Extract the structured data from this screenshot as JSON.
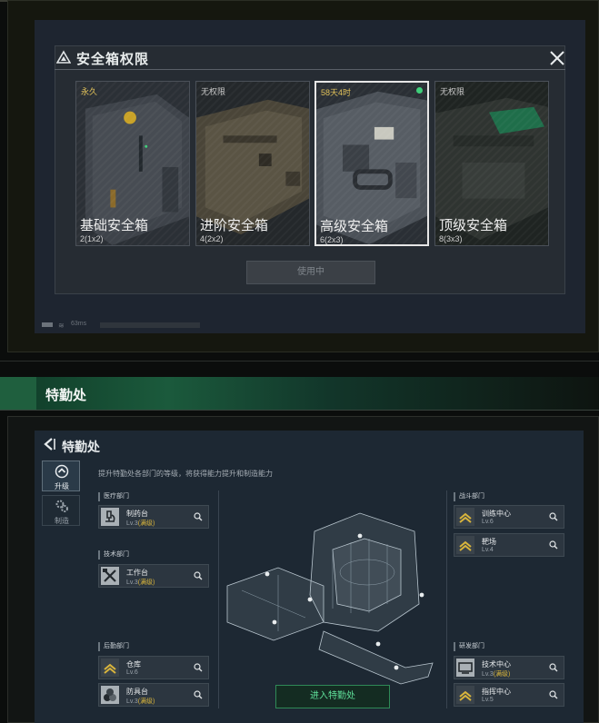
{
  "safebox": {
    "title": "安全箱权限",
    "cards": [
      {
        "tag": "永久",
        "name": "基础安全箱",
        "size": "2(1x2)"
      },
      {
        "tag": "无权限",
        "name": "进阶安全箱",
        "size": "4(2x2)"
      },
      {
        "tag": "58天4时",
        "name": "高级安全箱",
        "size": "6(2x3)"
      },
      {
        "tag": "无权限",
        "name": "顶级安全箱",
        "size": "8(3x3)"
      }
    ],
    "use_button": "使用中",
    "status_text": "63ms"
  },
  "section": {
    "title": "特勤处"
  },
  "special_service": {
    "title": "特勤处",
    "description": "提升特勤处各部门的等级，将获得能力提升和制造能力",
    "tabs": [
      {
        "label": "升级",
        "icon": "upgrade-icon"
      },
      {
        "label": "制造",
        "icon": "gears-icon"
      }
    ],
    "departments": {
      "medical": {
        "label": "医疗部门",
        "facilities": [
          {
            "name": "制药台",
            "level": "Lv.3",
            "max": "(满级)",
            "icon": "microscope-icon"
          }
        ]
      },
      "tech": {
        "label": "技术部门",
        "facilities": [
          {
            "name": "工作台",
            "level": "Lv.3",
            "max": "(满级)",
            "icon": "tools-icon"
          }
        ]
      },
      "logistics": {
        "label": "后勤部门",
        "facilities": [
          {
            "name": "仓库",
            "level": "Lv.6",
            "max": "",
            "icon": "rank-chevron-icon"
          },
          {
            "name": "防具台",
            "level": "Lv.3",
            "max": "(满级)",
            "icon": "armor-icon"
          }
        ]
      },
      "combat": {
        "label": "战斗部门",
        "facilities": [
          {
            "name": "训练中心",
            "level": "Lv.6",
            "max": "",
            "icon": "rank-chevron-icon"
          },
          {
            "name": "靶场",
            "level": "Lv.4",
            "max": "",
            "icon": "rank-chevron-icon"
          }
        ]
      },
      "research": {
        "label": "研发部门",
        "facilities": [
          {
            "name": "技术中心",
            "level": "Lv.3",
            "max": "(满级)",
            "icon": "computer-icon"
          },
          {
            "name": "指挥中心",
            "level": "Lv.5",
            "max": "",
            "icon": "rank-chevron-icon"
          }
        ]
      }
    },
    "enter_button": "进入特勤处"
  },
  "colors": {
    "accent_green": "#3fcf7a",
    "max_level_gold": "#d9b53c",
    "band_green": "#1b5a3c"
  }
}
